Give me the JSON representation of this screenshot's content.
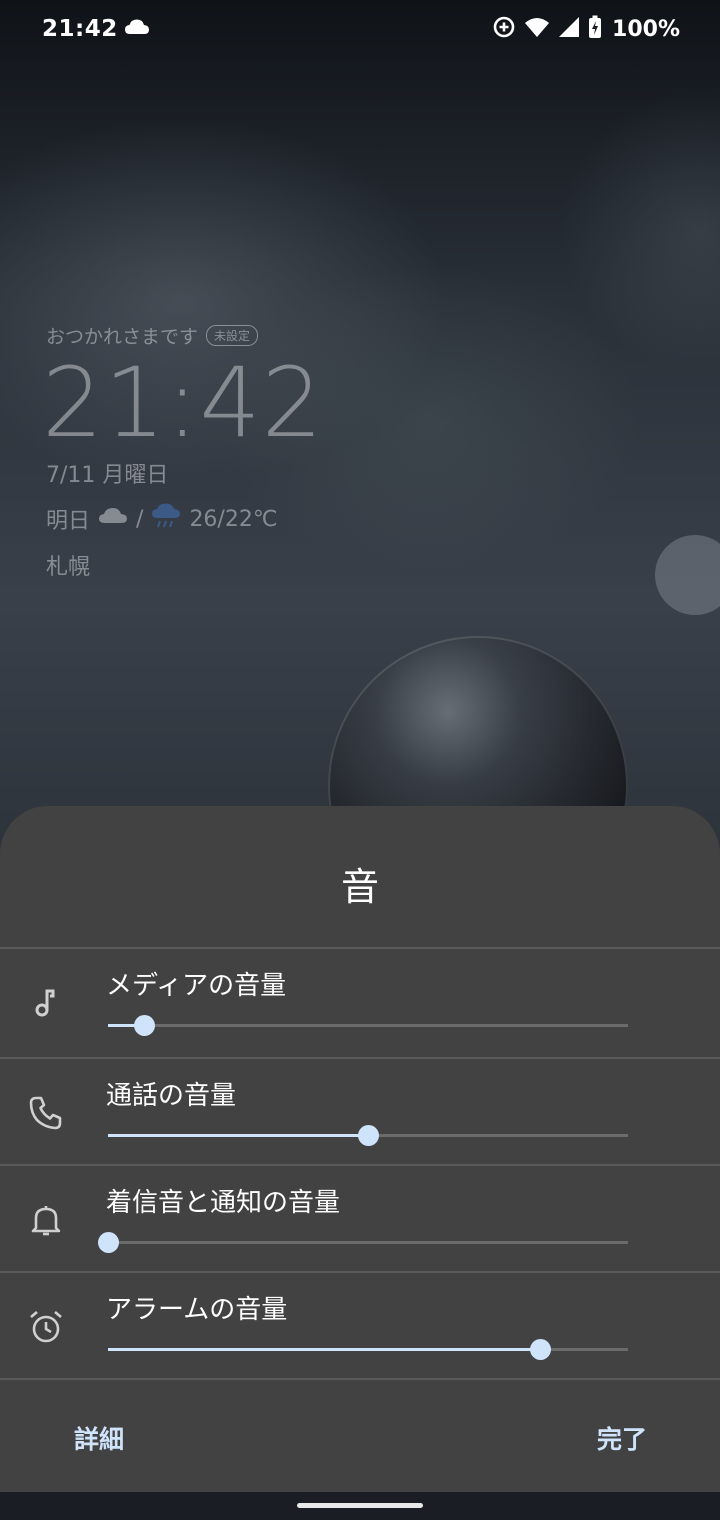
{
  "status_bar": {
    "time": "21:42",
    "battery_percent": "100%",
    "icons": [
      "cloud-icon",
      "data-saver-icon",
      "wifi-icon",
      "cellular-signal-icon",
      "battery-charging-icon"
    ]
  },
  "lock_widget": {
    "greeting": "おつかれさまです",
    "badge": "未設定",
    "time": "21:42",
    "date": "7/11 月曜日",
    "weather_label": "明日",
    "weather_separator": "/",
    "temperature": "26/22℃",
    "location": "札幌"
  },
  "sound_panel": {
    "title": "音",
    "sliders": [
      {
        "label": "メディアの音量",
        "icon": "music-note-icon",
        "level": 0.07
      },
      {
        "label": "通話の音量",
        "icon": "phone-icon",
        "level": 0.5
      },
      {
        "label": "着信音と通知の音量",
        "icon": "bell-icon",
        "level": 0.0
      },
      {
        "label": "アラームの音量",
        "icon": "alarm-clock-icon",
        "level": 0.83
      }
    ],
    "details_button": "詳細",
    "done_button": "完了"
  },
  "colors": {
    "panel_background": "#424242",
    "accent": "#cfe3fb",
    "slider_track": "#6b6b6b"
  }
}
